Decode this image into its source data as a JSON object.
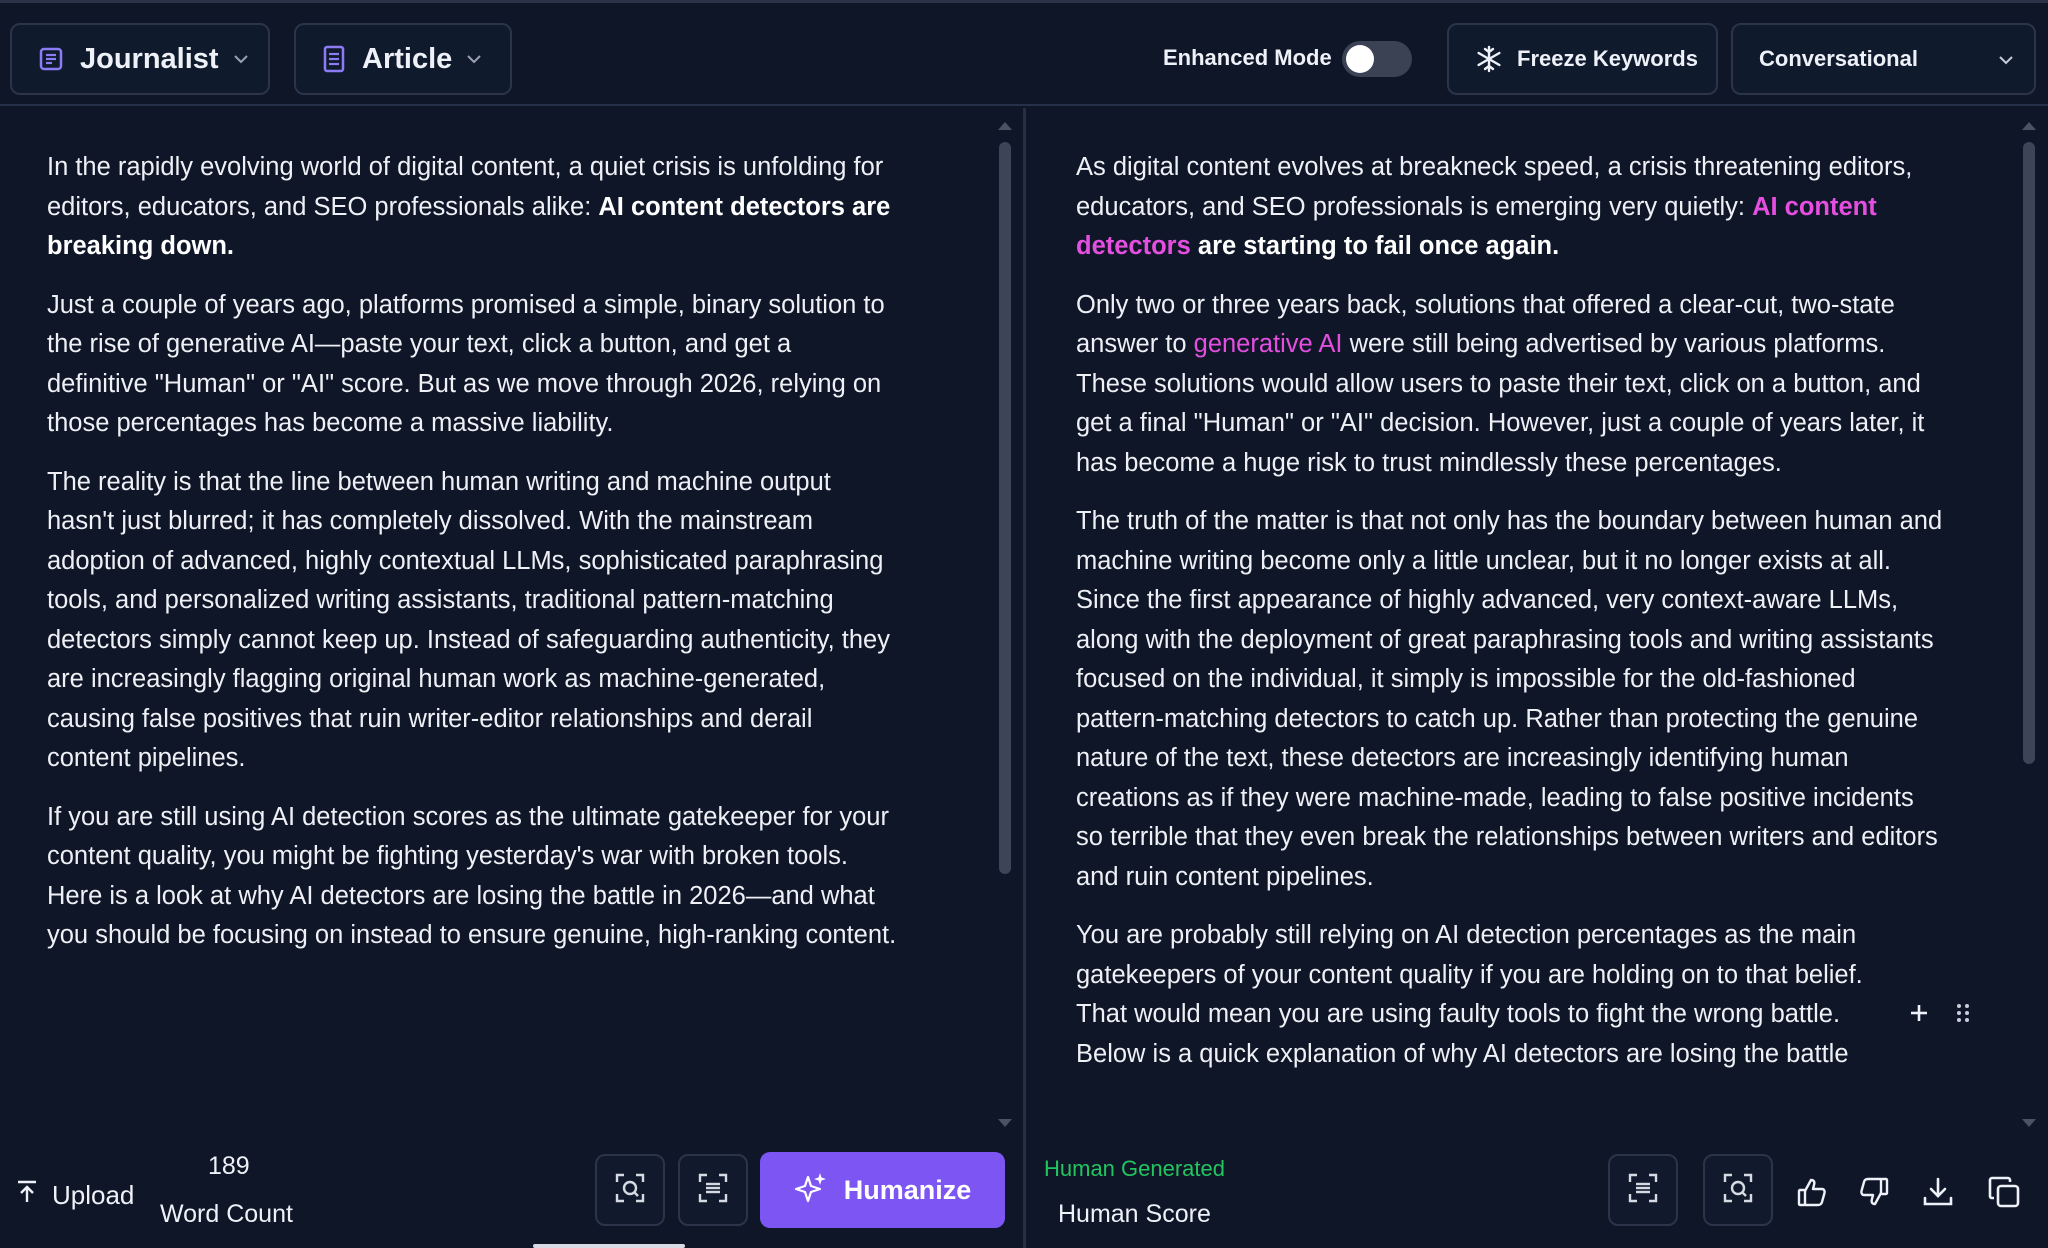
{
  "toolbar": {
    "persona_label": "Journalist",
    "content_type_label": "Article",
    "enhanced_mode_label": "Enhanced Mode",
    "enhanced_mode_on": false,
    "freeze_keywords_label": "Freeze Keywords",
    "tone_label": "Conversational"
  },
  "input": {
    "p1_text": "In the rapidly evolving world of digital content, a quiet crisis is unfolding for editors, educators, and SEO professionals alike: ",
    "p1_bold": "AI content detectors are breaking down.",
    "p2": "Just a couple of years ago, platforms promised a simple, binary solution to the rise of generative AI—paste your text, click a button, and get a definitive \"Human\" or \"AI\" score. But as we move through 2026, relying on those percentages has become a massive liability.",
    "p3": "The reality is that the line between human writing and machine output hasn't just blurred; it has completely dissolved. With the mainstream adoption of advanced, highly contextual LLMs, sophisticated paraphrasing tools, and personalized writing assistants, traditional pattern-matching detectors simply cannot keep up. Instead of safeguarding authenticity, they are increasingly flagging original human work as machine-generated, causing false positives that ruin writer-editor relationships and derail content pipelines.",
    "p4": "If you are still using AI detection scores as the ultimate gatekeeper for your content quality, you might be fighting yesterday's war with broken tools. Here is a look at why AI detectors are losing the battle in 2026—and what you should be focusing on instead to ensure genuine, high-ranking content."
  },
  "output": {
    "p1_text": "As digital content evolves at breakneck speed, a crisis threatening editors, educators, and SEO professionals is emerging very quietly: ",
    "p1_hl": "AI content detectors",
    "p1_bold": " are starting to fail once again.",
    "p2_a": "Only two or three years back, solutions that offered a clear-cut, two-state answer to ",
    "p2_hl": "generative AI",
    "p2_b": " were still being advertised by various platforms. These solutions would allow users to paste their text, click on a button, and get a final \"Human\" or \"AI\" decision. However, just a couple of years later, it has become a huge risk to trust mindlessly these percentages.",
    "p3": "The truth of the matter is that not only has the boundary between human and machine writing become only a little unclear, but it no longer exists at all. Since the first appearance of highly advanced, very context-aware LLMs, along with the deployment of great paraphrasing tools and writing assistants focused on the individual, it simply is impossible for the old-fashioned pattern-matching detectors to catch up. Rather than protecting the genuine nature of the text, these detectors are increasingly identifying human creations as if they were machine-made, leading to false positive incidents so terrible that they even break the relationships between writers and editors and ruin content pipelines.",
    "p4": "You are probably still relying on AI detection percentages as the main gatekeepers of your content quality if you are holding on to that belief. That would mean you are using faulty tools to fight the wrong battle. Below is a quick explanation of why AI detectors are losing the battle"
  },
  "footer_left": {
    "upload_label": "Upload",
    "word_count_value": "189",
    "word_count_label": "Word Count",
    "humanize_label": "Humanize"
  },
  "footer_right": {
    "status_label": "Human Generated",
    "score_label": "Human Score"
  },
  "colors": {
    "background": "#0e1628",
    "accent": "#7c55f2",
    "highlight": "#e44fe0",
    "status_green": "#22c55e"
  }
}
